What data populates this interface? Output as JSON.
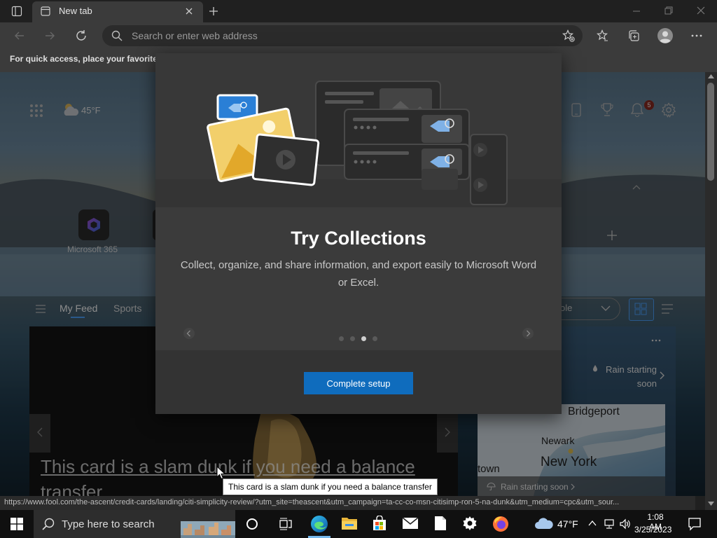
{
  "browser": {
    "tab_title": "New tab",
    "address_placeholder": "Search or enter web address",
    "favorites_bar_message": "For quick access, place your favorites h"
  },
  "newtab": {
    "weather_temp": "45°F",
    "quick_links": [
      {
        "label": "Microsoft 365"
      }
    ],
    "notifications_count": "5",
    "feed_tabs": [
      {
        "label": "My Feed"
      },
      {
        "label": "Sports"
      }
    ],
    "dropdown_value": "ole",
    "card_title": "This card is a slam dunk if you need a balance transfer",
    "weather_card": {
      "rain_message": "Rain starting soon",
      "map_labels": [
        "Bridgeport",
        "Newark",
        "New York",
        "town"
      ],
      "map_rain_message": "Rain starting soon"
    }
  },
  "modal": {
    "title": "Try Collections",
    "description": "Collect, organize, and share information, and export easily to Microsoft Word or Excel.",
    "button_label": "Complete setup",
    "page_count": 4,
    "current_page": 3
  },
  "status_url": "https://www.fool.com/the-ascent/credit-cards/landing/citi-simplicity-review/?utm_site=theascent&utm_campaign=ta-cc-co-msn-citisimp-ron-5-na-dunk&utm_medium=cpc&utm_sour...",
  "tooltip": "This card is a slam dunk if you need a balance transfer",
  "taskbar": {
    "search_placeholder": "Type here to search",
    "temperature": "47°F",
    "time": "1:08 AM",
    "date": "3/25/2023"
  },
  "colors": {
    "accent": "#0f6cbd",
    "link_blue": "#4da3ff",
    "notification_badge": "#c42b1c"
  }
}
